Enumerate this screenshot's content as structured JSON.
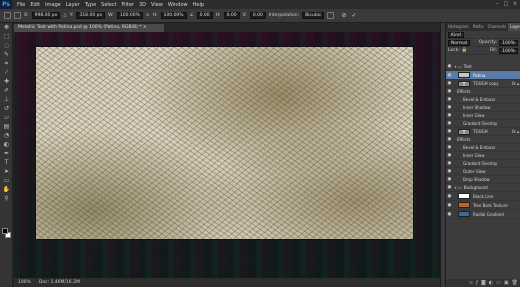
{
  "app": {
    "logo": "Ps"
  },
  "menu": [
    "File",
    "Edit",
    "Image",
    "Layer",
    "Type",
    "Select",
    "Filter",
    "3D",
    "View",
    "Window",
    "Help"
  ],
  "window_controls": [
    "–",
    "□",
    "×"
  ],
  "options": {
    "x_label": "X:",
    "x_value": "998.00 px",
    "y_label": "Y:",
    "y_value": "318.00 px",
    "w_label": "W:",
    "w_value": "100.00%",
    "h_label": "H:",
    "h_value": "100.00%",
    "angle_value": "0.00",
    "h_skew_label": "H:",
    "h_skew_value": "0.00",
    "v_skew_label": "V:",
    "v_skew_value": "0.00",
    "interp_label": "Interpolation:",
    "interp_value": "Bicubic",
    "cancel": "⊘",
    "commit": "✓"
  },
  "document": {
    "tab_title": "Metallic Text with Patina.psd @ 100% (Patina, RGB/8) *",
    "tab_close": "×"
  },
  "status": {
    "zoom": "100%",
    "doc_info": "Doc: 1.46M/16.2M"
  },
  "panel": {
    "tabs": [
      "Histogram",
      "Paths",
      "Channels",
      "Layers"
    ],
    "active_tab_index": 3,
    "blend_mode": "Normal",
    "opacity_label": "Opacity:",
    "opacity_value": "100%",
    "lock_label": "Lock:",
    "fill_label": "Fill:",
    "fill_value": "100%",
    "kind_label": "Kind"
  },
  "layers": [
    {
      "name": "Text",
      "type": "group",
      "visible": true
    },
    {
      "name": "Patina",
      "type": "layer",
      "selected": true,
      "visible": true
    },
    {
      "name": "TOUGH copy",
      "type": "text",
      "fx": true,
      "visible": true
    },
    {
      "name": "Effects",
      "type": "effects-header"
    },
    {
      "name": "Bevel & Emboss",
      "type": "effect"
    },
    {
      "name": "Inner Shadow",
      "type": "effect"
    },
    {
      "name": "Inner Glow",
      "type": "effect"
    },
    {
      "name": "Gradient Overlay",
      "type": "effect"
    },
    {
      "name": "TOUGH",
      "type": "text",
      "fx": true,
      "visible": true
    },
    {
      "name": "Effects",
      "type": "effects-header"
    },
    {
      "name": "Bevel & Emboss",
      "type": "effect"
    },
    {
      "name": "Inner Glow",
      "type": "effect"
    },
    {
      "name": "Gradient Overlay",
      "type": "effect"
    },
    {
      "name": "Outer Glow",
      "type": "effect"
    },
    {
      "name": "Drop Shadow",
      "type": "effect"
    },
    {
      "name": "Background",
      "type": "group",
      "visible": true
    },
    {
      "name": "Black Line",
      "type": "layer",
      "visible": true
    },
    {
      "name": "Tree Bark Texture",
      "type": "layer",
      "visible": true
    },
    {
      "name": "Radial Gradient",
      "type": "layer",
      "visible": true
    }
  ],
  "colors": {
    "selection": "#5a7aa8",
    "menu_bg": "#2d2d2d",
    "options_bg": "#3a3a3a",
    "panel_bg": "#3c3c3c"
  }
}
